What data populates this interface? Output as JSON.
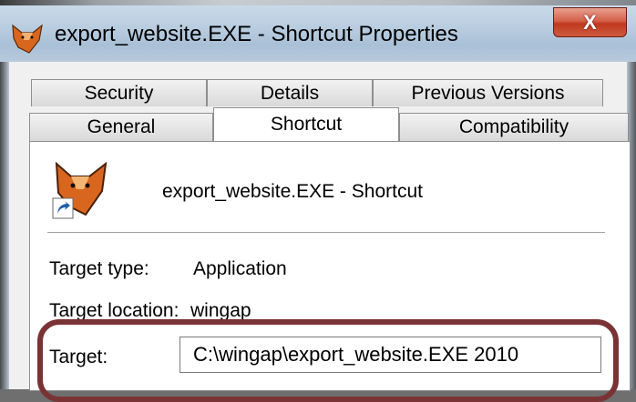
{
  "window": {
    "title": "export_website.EXE - Shortcut Properties",
    "close_glyph": "X"
  },
  "tabs_row_back": [
    {
      "label": "Security"
    },
    {
      "label": "Details"
    },
    {
      "label": "Previous Versions"
    }
  ],
  "tabs_row_front": [
    {
      "label": "General"
    },
    {
      "label": "Shortcut",
      "active": true
    },
    {
      "label": "Compatibility"
    }
  ],
  "shortcut": {
    "name": "export_website.EXE - Shortcut",
    "fields": {
      "target_type_label": "Target type:",
      "target_type_value": "Application",
      "target_location_label": "Target location:",
      "target_location_value": "wingap",
      "target_label": "Target:",
      "target_value": "C:\\wingap\\export_website.EXE 2010"
    }
  },
  "colors": {
    "highlight_border": "#7a3335",
    "close_button": "#c0391f"
  },
  "icons": [
    "fox-app-icon",
    "close-icon",
    "shortcut-arrow-icon"
  ]
}
